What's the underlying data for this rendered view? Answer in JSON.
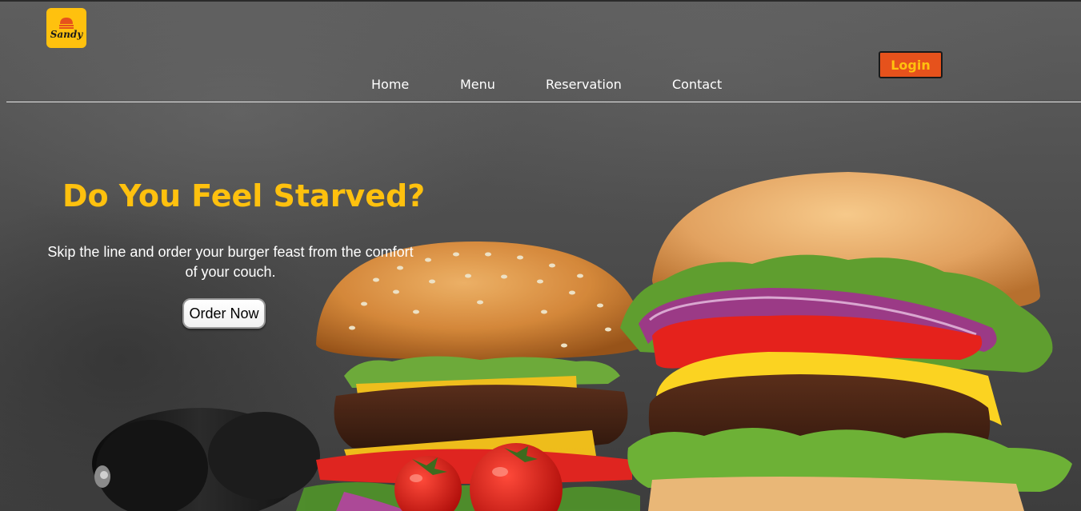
{
  "brand": {
    "logo_text": "Sandy",
    "accent": "#ffc10e",
    "login_color": "#e6521c"
  },
  "nav": {
    "items": [
      {
        "label": "Home"
      },
      {
        "label": "Menu"
      },
      {
        "label": "Reservation"
      },
      {
        "label": "Contact"
      }
    ],
    "login_label": "Login"
  },
  "hero": {
    "title": "Do You Feel Starved?",
    "subtitle": "Skip the line and order your burger feast from the comfort of your couch.",
    "cta_label": "Order Now"
  }
}
